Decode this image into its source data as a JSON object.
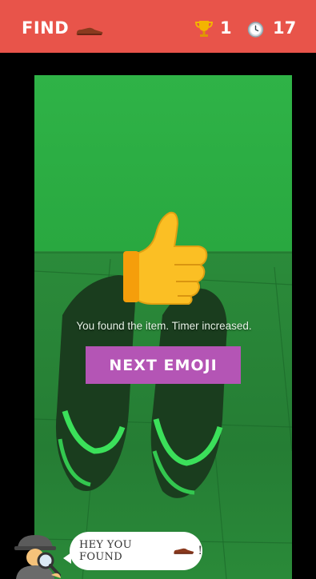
{
  "header": {
    "find_label": "FIND",
    "target_icon": "shoe-icon",
    "score": "1",
    "timer": "17",
    "colors": {
      "bar": "#e8544a",
      "text": "#ffffff"
    }
  },
  "camera": {
    "overlay_icon": "thumbs-up-icon",
    "message": "You found the item. Timer increased.",
    "next_button_label": "NEXT EMOJI",
    "colors": {
      "tint": "#2fb347",
      "button": "#b455b5"
    }
  },
  "helper": {
    "avatar_icon": "detective-icon",
    "bubble_text": "HEY YOU FOUND",
    "bubble_icon": "shoe-icon",
    "bubble_end": "!"
  }
}
